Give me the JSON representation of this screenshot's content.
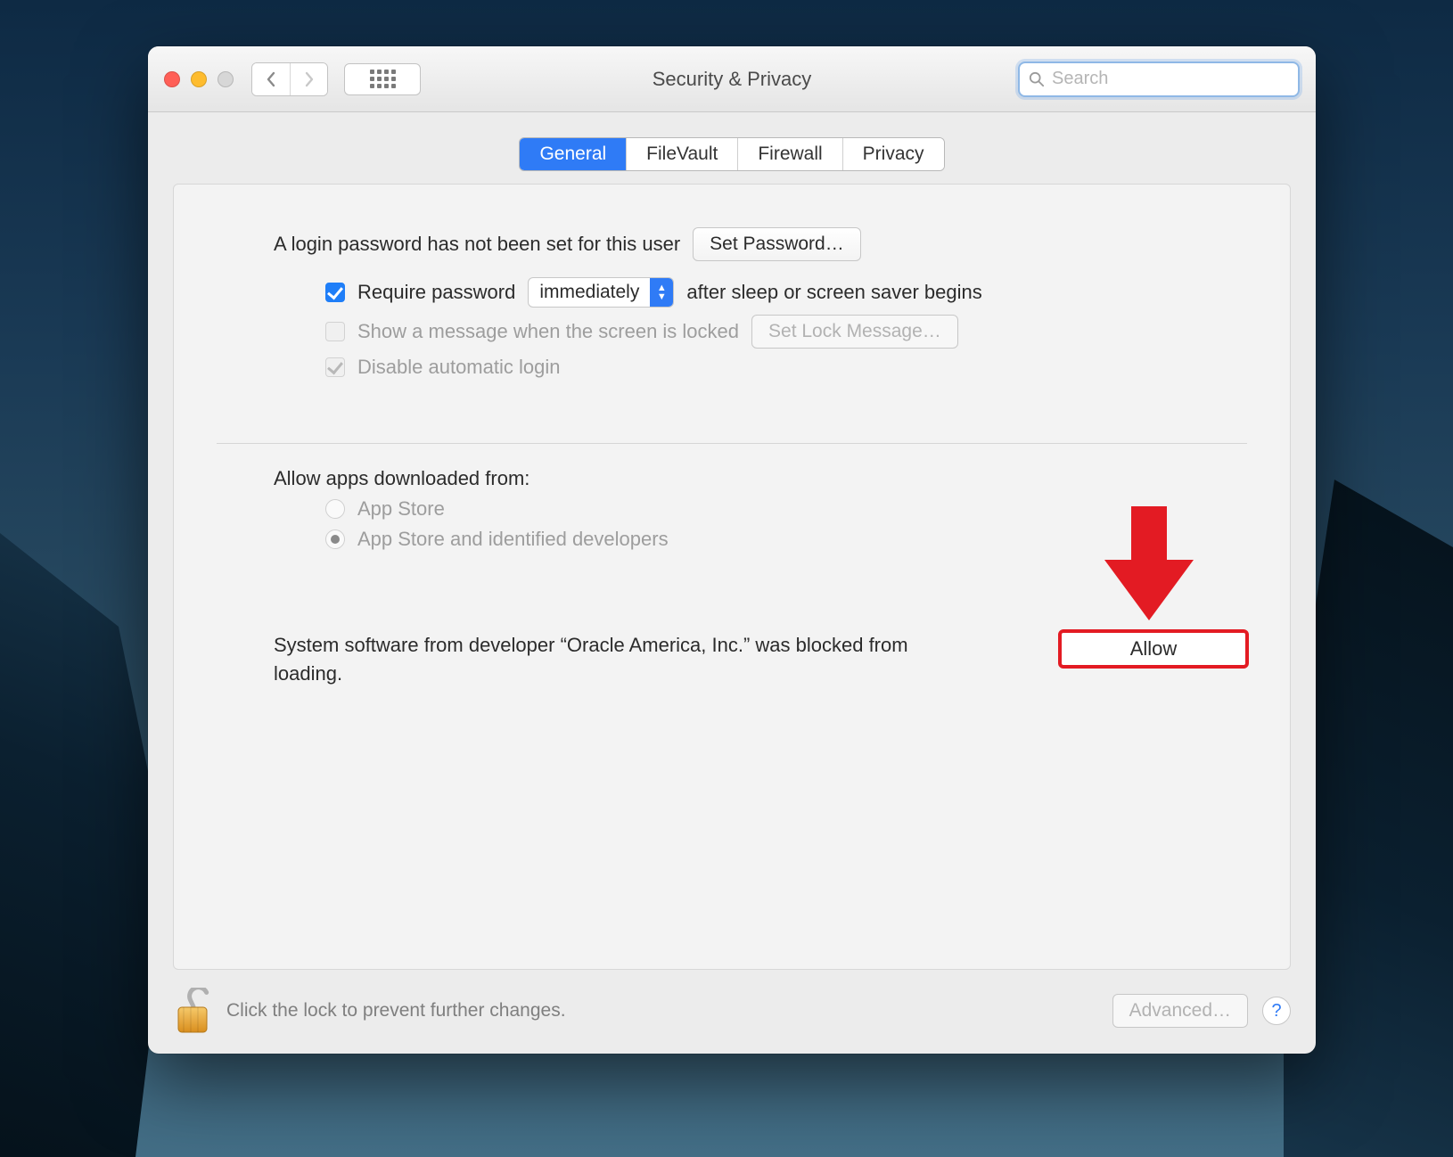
{
  "window": {
    "title": "Security & Privacy"
  },
  "search": {
    "placeholder": "Search"
  },
  "tabs": {
    "general": "General",
    "filevault": "FileVault",
    "firewall": "Firewall",
    "privacy": "Privacy"
  },
  "general": {
    "login_not_set": "A login password has not been set for this user",
    "set_password_btn": "Set Password…",
    "require_password_label": "Require password",
    "require_password_select": "immediately",
    "require_password_after": "after sleep or screen saver begins",
    "show_message_label": "Show a message when the screen is locked",
    "set_lock_message_btn": "Set Lock Message…",
    "disable_auto_login": "Disable automatic login",
    "allow_apps_heading": "Allow apps downloaded from:",
    "radio_app_store": "App Store",
    "radio_identified": "App Store and identified developers",
    "blocked_text": "System software from developer “Oracle America, Inc.” was blocked from loading.",
    "allow_btn": "Allow"
  },
  "footer": {
    "lock_hint": "Click the lock to prevent further changes.",
    "advanced_btn": "Advanced…",
    "help": "?"
  }
}
